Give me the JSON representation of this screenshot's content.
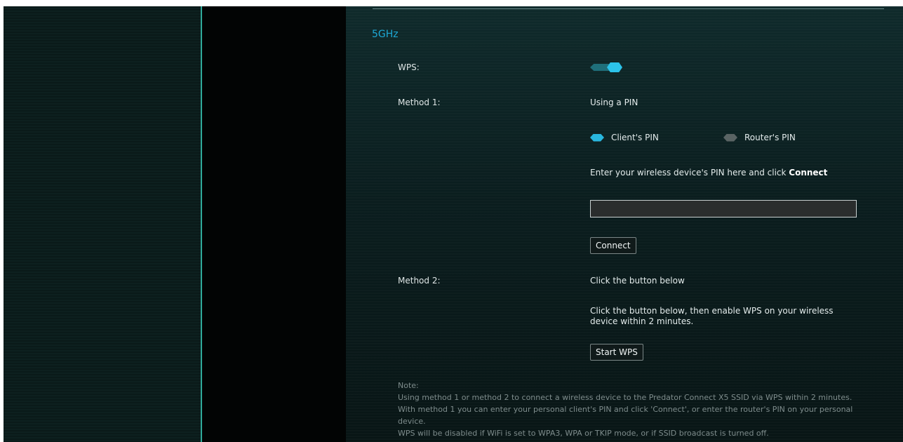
{
  "section": {
    "title": "5GHz"
  },
  "wps": {
    "label": "WPS:",
    "enabled": true,
    "accent": "#2cc3ea"
  },
  "method1": {
    "label": "Method 1:",
    "title": "Using a PIN",
    "options": [
      {
        "label": "Client's PIN",
        "selected": true
      },
      {
        "label": "Router's PIN",
        "selected": false
      }
    ],
    "instruction_prefix": "Enter your wireless device's PIN here and click ",
    "instruction_bold": "Connect",
    "pin_value": "",
    "connect_button": "Connect"
  },
  "method2": {
    "label": "Method 2:",
    "title": "Click the button below",
    "description": "Click the button below, then enable WPS on your wireless device within 2 minutes.",
    "start_button": "Start WPS"
  },
  "note": {
    "heading": "Note:",
    "line1": "Using method 1 or method 2 to connect a wireless device to the Predator Connect X5 SSID via WPS within 2 minutes. With method 1 you can enter your personal client's PIN and click 'Connect', or enter the router's PIN on your personal device.",
    "line2": "WPS will be disabled if WiFi is set to WPA3, WPA or TKIP mode, or if SSID broadcast is turned off."
  }
}
